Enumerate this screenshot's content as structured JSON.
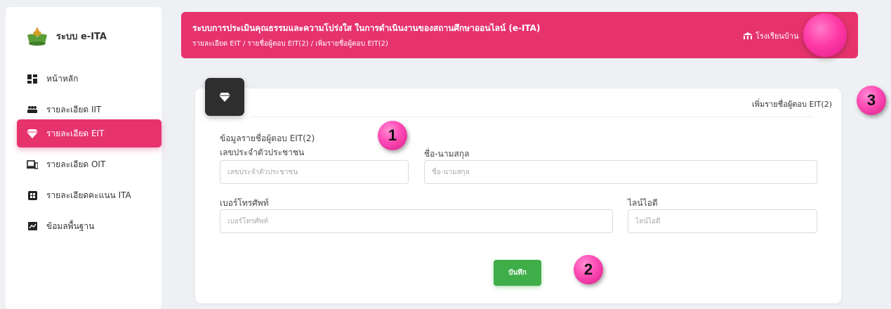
{
  "sidebar": {
    "brand": "ระบบ e-ITA",
    "items": [
      {
        "label": "หน้าหลัก",
        "icon": "dashboard-icon"
      },
      {
        "label": "รายละเอียด IIT",
        "icon": "users-icon"
      },
      {
        "label": "รายละเอียด EIT",
        "icon": "gem-icon"
      },
      {
        "label": "รายละเอียด OIT",
        "icon": "devices-icon"
      },
      {
        "label": "รายละเอียดคะแนน ITA",
        "icon": "grid-icon"
      },
      {
        "label": "ข้อมลพื้นฐาน",
        "icon": "chart-icon"
      }
    ],
    "active_index": 2
  },
  "header": {
    "title": "ระบบการประเมินคุณธรรมและความโปร่งใส ในการดำเนินงานของสถานศึกษาออนไลน์ (e-ITA)",
    "breadcrumb": "รายละเอียด EIT  /  รายชื่อผู้ตอบ EIT(2)  /  เพิ่มรายชื่อผู้ตอบ EIT(2)",
    "school": "โรงเรียนบ้าน",
    "accent": "#e6336e"
  },
  "card": {
    "title": "เพิ่มรายชื่อผู้ตอบ EIT(2)",
    "section_title": "ข้อมูลรายชื่อผู้ตอบ EIT(2)",
    "fields": {
      "citizen_id": {
        "label": "เลขประจำตัวประชาชน",
        "placeholder": "เลขประจำตัวประชาชน",
        "value": ""
      },
      "full_name": {
        "label": "ชื่อ-นามสกุล",
        "placeholder": "ชื่อ-นามสกุล",
        "value": ""
      },
      "phone": {
        "label": "เบอร์โทรศัพท์",
        "placeholder": "เบอร์โทรศัพท์",
        "value": ""
      },
      "line_id": {
        "label": "ไลน์ไอดี",
        "placeholder": "ไลน์ไอดี",
        "value": ""
      }
    },
    "save_label": "บันทึก",
    "save_color": "#3fae49"
  },
  "badges": [
    "1",
    "2",
    "3"
  ]
}
